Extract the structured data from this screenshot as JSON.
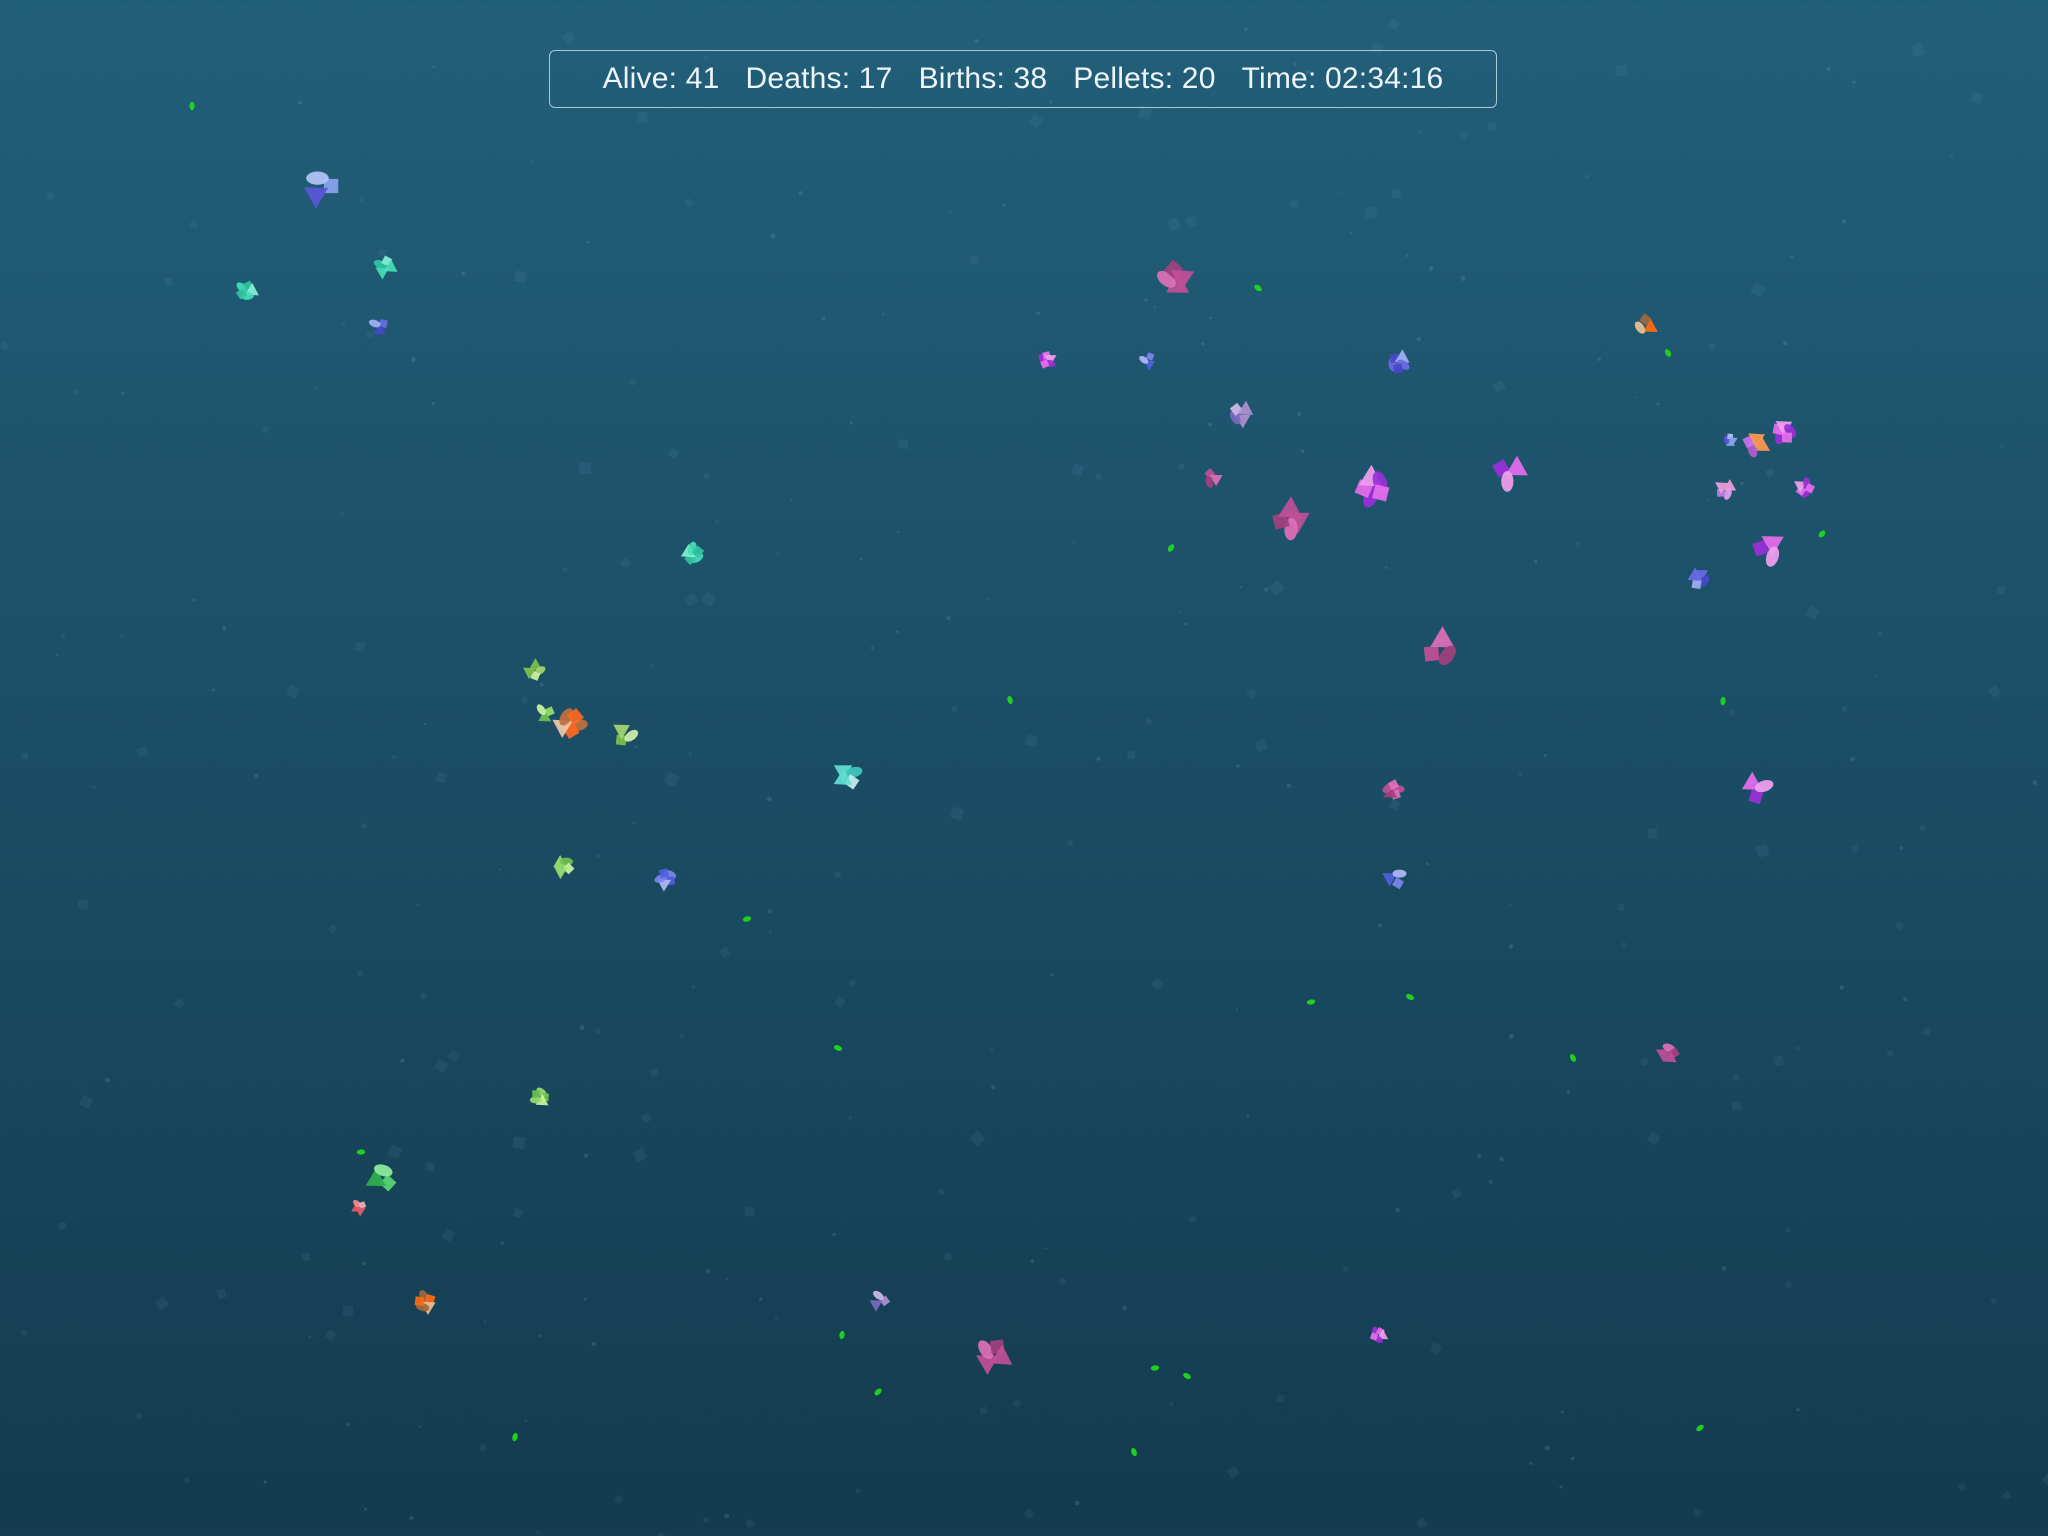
{
  "hud": {
    "alive": "Alive: 41",
    "deaths": "Deaths: 17",
    "births": "Births: 38",
    "pellets": "Pellets: 20",
    "time": "Time: 02:34:16"
  },
  "stats": {
    "alive": 41,
    "deaths": 17,
    "births": 38,
    "pellets": 20,
    "time": "02:34:16"
  },
  "colors": {
    "background_top": "#225f79",
    "background_bottom": "#143b4f",
    "pellet": "#1fd11f",
    "hud_text": "#eef6fb"
  },
  "creature_palettes": [
    [
      "#8aa4ee",
      "#5b56d8",
      "#b3c6f5"
    ],
    [
      "#44e0b8",
      "#30c3a0",
      "#8af0d4"
    ],
    [
      "#6a6ae8",
      "#4a48c8",
      "#9fb0f5"
    ],
    [
      "#c24f98",
      "#e070b8",
      "#a3407f"
    ],
    [
      "#9b2fd8",
      "#e86ef0",
      "#f2a0ee"
    ],
    [
      "#7c86f0",
      "#5060e0",
      "#b0b8f8"
    ],
    [
      "#b090d0",
      "#7a6ac0",
      "#d0b8e8"
    ],
    [
      "#c07040",
      "#ff6820",
      "#f3c8a8"
    ],
    [
      "#ff9a50",
      "#b060d0",
      "#d070ee"
    ],
    [
      "#f0a0d8",
      "#e8a0f0",
      "#c080e0"
    ],
    [
      "#7ec04e",
      "#a4d870",
      "#cff0a8"
    ],
    [
      "#5ee0d0",
      "#3fc8c0",
      "#c8f0f0"
    ],
    [
      "#9ae070",
      "#6fc050",
      "#c8f8a0"
    ],
    [
      "#58d870",
      "#30b050",
      "#90f0a0"
    ],
    [
      "#e05a6a",
      "#ff8888",
      "#f0b0b8"
    ],
    [
      "#a06840",
      "#ff6a10",
      "#f0c090"
    ]
  ]
}
